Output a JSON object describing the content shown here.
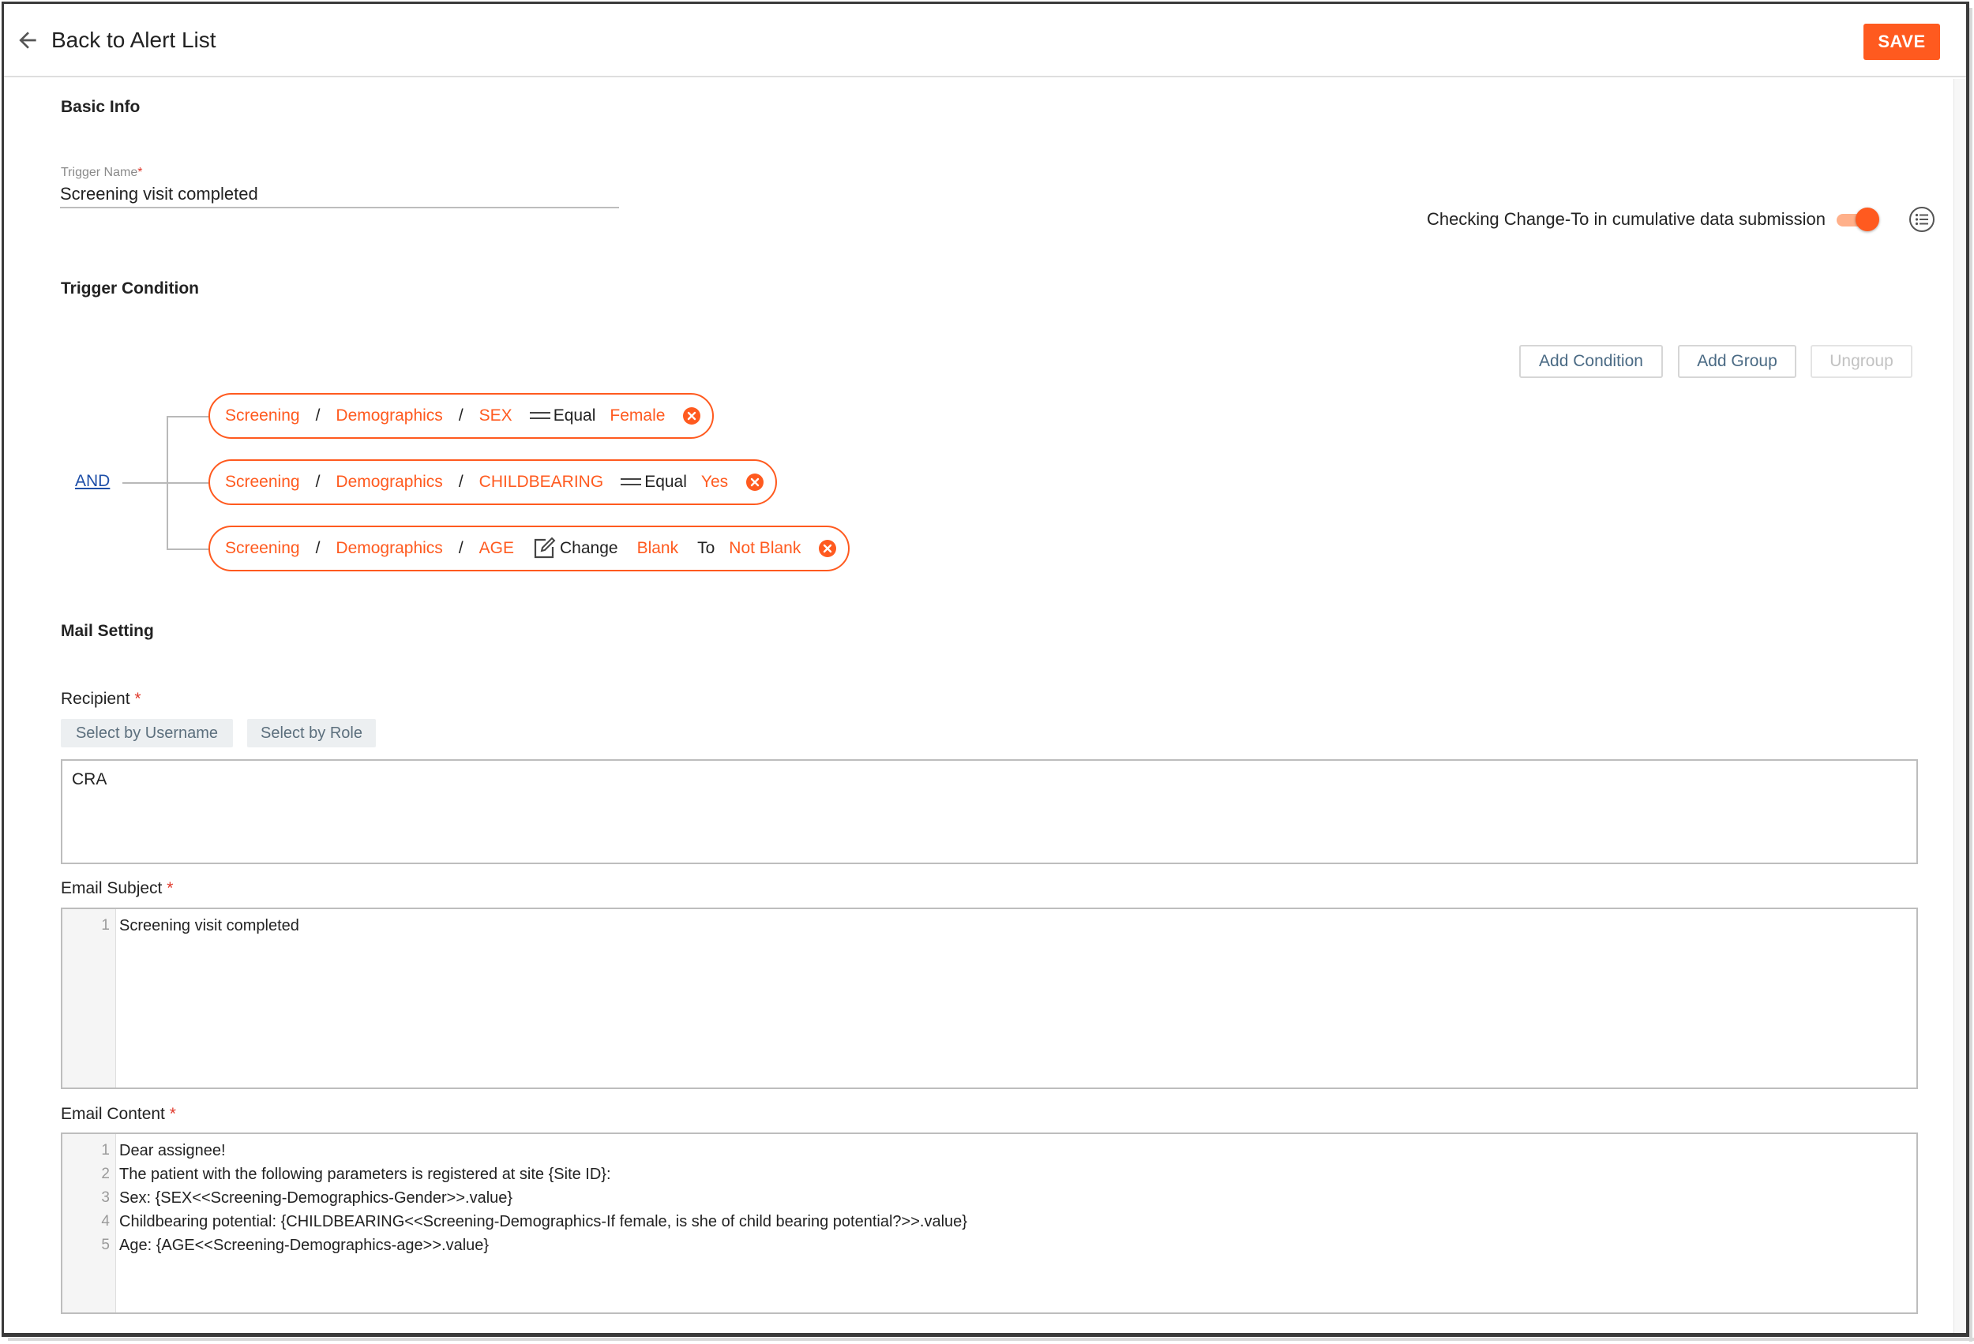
{
  "header": {
    "back_label": "Back to Alert List",
    "save_label": "SAVE"
  },
  "basic_info": {
    "title": "Basic Info",
    "trigger_name_label": "Trigger Name",
    "trigger_name_value": "Screening visit completed"
  },
  "trigger_condition": {
    "title": "Trigger Condition",
    "cumulative_label": "Checking Change-To in cumulative data submission",
    "cumulative_on": true,
    "buttons": {
      "add_condition": "Add Condition",
      "add_group": "Add Group",
      "ungroup": "Ungroup"
    },
    "logic_operator": "AND",
    "conditions": [
      {
        "form": "Screening",
        "section": "Demographics",
        "field": "SEX",
        "operator": "Equal",
        "value": "Female"
      },
      {
        "form": "Screening",
        "section": "Demographics",
        "field": "CHILDBEARING",
        "operator": "Equal",
        "value": "Yes"
      },
      {
        "form": "Screening",
        "section": "Demographics",
        "field": "AGE",
        "operator": "Change",
        "from": "Blank",
        "to_label": "To",
        "to": "Not Blank"
      }
    ],
    "separator": "/"
  },
  "mail_setting": {
    "title": "Mail Setting",
    "recipient_label": "Recipient",
    "select_by_username": "Select by Username",
    "select_by_role": "Select by Role",
    "recipient_value": "CRA",
    "subject_label": "Email Subject",
    "subject_lines": [
      {
        "num": "1",
        "text": "Screening visit completed"
      }
    ],
    "content_label": "Email Content",
    "content_lines": [
      {
        "num": "1",
        "text": "Dear assignee!"
      },
      {
        "num": "2",
        "text": "The patient with the following parameters is registered at site {Site ID}:"
      },
      {
        "num": "3",
        "text": "Sex: {SEX<<Screening-Demographics-Gender>>.value}"
      },
      {
        "num": "4",
        "text": "Childbearing potential: {CHILDBEARING<<Screening-Demographics-If female, is she of child bearing potential?>>.value}"
      },
      {
        "num": "5",
        "text": "Age: {AGE<<Screening-Demographics-age>>.value}"
      }
    ]
  },
  "colors": {
    "accent": "#ff5a1f",
    "link": "#1e4fa8",
    "required": "#e0392b"
  }
}
